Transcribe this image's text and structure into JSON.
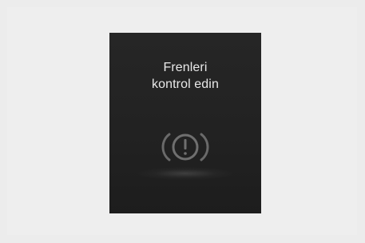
{
  "warning_screen": {
    "message_line1": "Frenleri",
    "message_line2": "kontrol edin",
    "icon": "brake-warning-icon",
    "colors": {
      "background": "#ececec",
      "panel": "#242424",
      "text": "#e9e9e9",
      "icon": "#6e6e6e"
    }
  }
}
